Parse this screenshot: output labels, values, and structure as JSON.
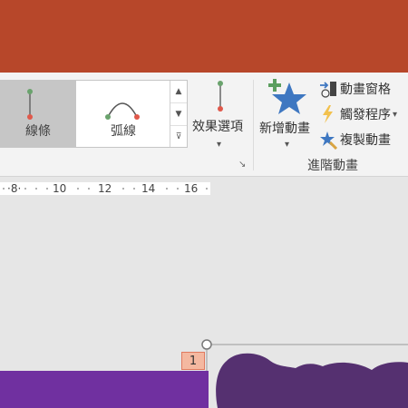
{
  "ribbon": {
    "gallery": {
      "items": [
        {
          "label": "線條",
          "selected": true
        },
        {
          "label": "弧線",
          "selected": false
        }
      ],
      "scroll": [
        "▲",
        "▼",
        "⊽"
      ]
    },
    "effect_options": {
      "label": "效果選項",
      "dropdown": "▾"
    },
    "add_animation": {
      "label": "新增動畫",
      "dropdown": "▾"
    },
    "small_buttons": [
      {
        "label": "動畫窗格",
        "icon": "animation-pane-icon"
      },
      {
        "label": "觸發程序",
        "icon": "lightning-icon",
        "dropdown": "▾"
      },
      {
        "label": "複製動畫",
        "icon": "animation-painter-icon"
      }
    ],
    "group_label": "進階動畫",
    "launcher": "↘"
  },
  "ruler": {
    "ticks": [
      "·8·",
      "10",
      "12",
      "14",
      "16"
    ]
  },
  "slide": {
    "sequence_tag": "1"
  },
  "colors": {
    "title_bar": "#b7472a",
    "purple": "#7030a0",
    "dark_purple": "#553070"
  }
}
